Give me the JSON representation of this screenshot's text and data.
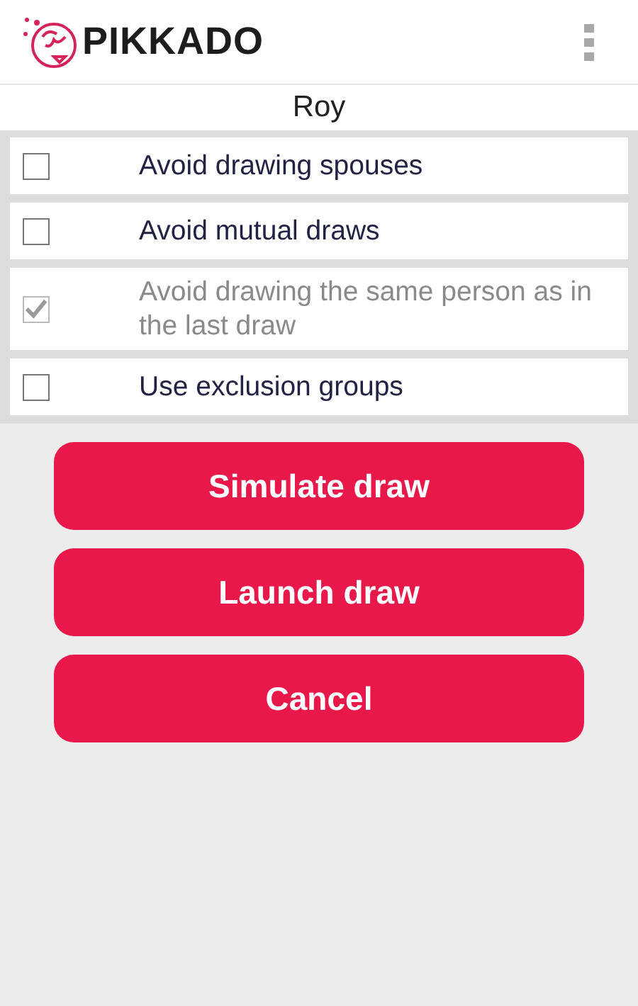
{
  "app_bar": {
    "logo_text": "PIKKADO"
  },
  "person": "Roy",
  "options": [
    {
      "label": "Avoid drawing spouses",
      "checked": false,
      "disabled": false
    },
    {
      "label": "Avoid mutual draws",
      "checked": false,
      "disabled": false
    },
    {
      "label": "Avoid drawing the same person as in the last draw",
      "checked": true,
      "disabled": true
    },
    {
      "label": "Use exclusion groups",
      "checked": false,
      "disabled": false
    }
  ],
  "buttons": [
    "Simulate draw",
    "Launch draw",
    "Cancel"
  ]
}
